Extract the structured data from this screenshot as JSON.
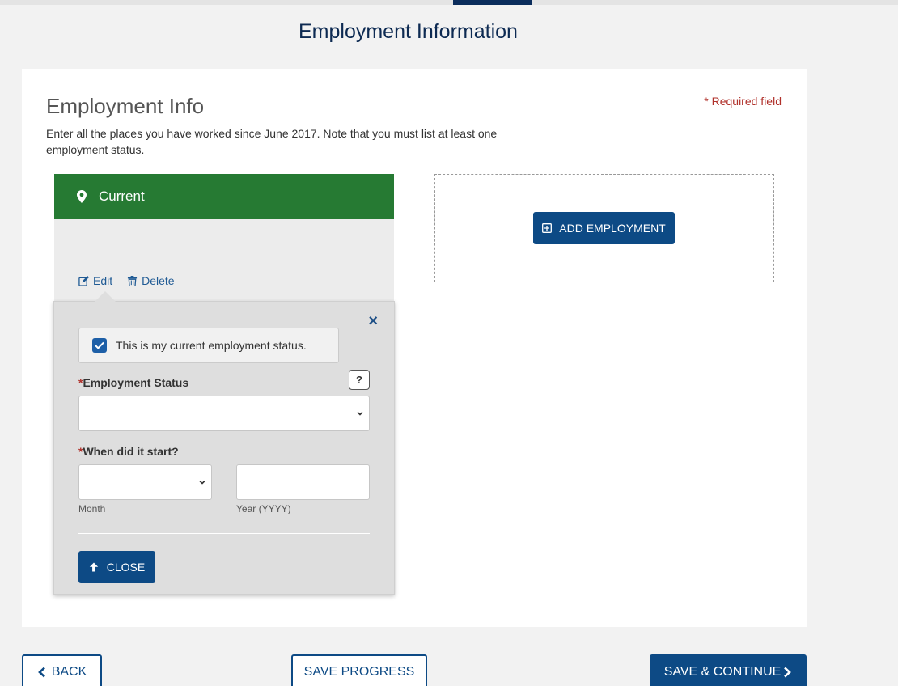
{
  "page": {
    "title": "Employment Information"
  },
  "section": {
    "title": "Employment Info",
    "required_note": "* Required field",
    "intro": "Enter all the places you have worked since June 2017. Note that you must list at least one employment status."
  },
  "employment_card": {
    "header": "Current",
    "header_icon": "map-marker-icon",
    "actions": {
      "edit": "Edit",
      "delete": "Delete"
    }
  },
  "popover": {
    "close_symbol": "×",
    "current_checkbox": {
      "label": "This is my current employment status.",
      "checked": true
    },
    "employment_status": {
      "required_mark": "*",
      "label": "Employment Status",
      "help": "?",
      "value": ""
    },
    "start": {
      "required_mark": "*",
      "label": "When did it start?",
      "month_label": "Month",
      "year_label": "Year (YYYY)",
      "month_value": "",
      "year_value": ""
    },
    "close_button": "CLOSE"
  },
  "add_employment": {
    "label": "ADD EMPLOYMENT"
  },
  "navigation": {
    "back": "BACK",
    "save_progress": "SAVE PROGRESS",
    "save_continue": "SAVE & CONTINUE"
  },
  "colors": {
    "header_green": "#267a33",
    "primary_blue": "#0d4a85",
    "required_red": "#b0302a",
    "title_navy": "#0d2a52"
  }
}
